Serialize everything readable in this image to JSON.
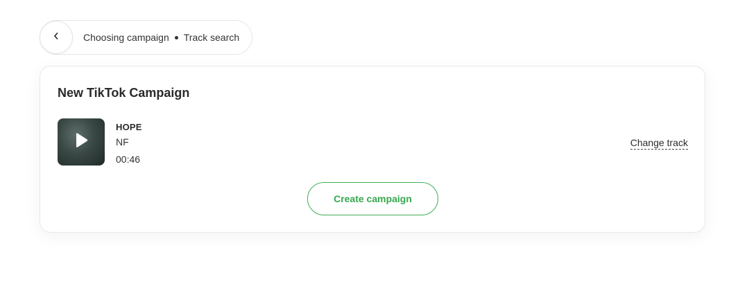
{
  "breadcrumb": {
    "items": [
      "Choosing campaign",
      "Track search"
    ]
  },
  "card": {
    "title": "New TikTok Campaign",
    "track": {
      "title": "HOPE",
      "artist": "NF",
      "duration": "00:46"
    },
    "change_track_label": "Change track",
    "create_button_label": "Create campaign"
  },
  "colors": {
    "accent": "#3fae55",
    "border": "#e8e8e8"
  },
  "icons": {
    "back": "chevron-left-icon",
    "play": "play-icon"
  }
}
